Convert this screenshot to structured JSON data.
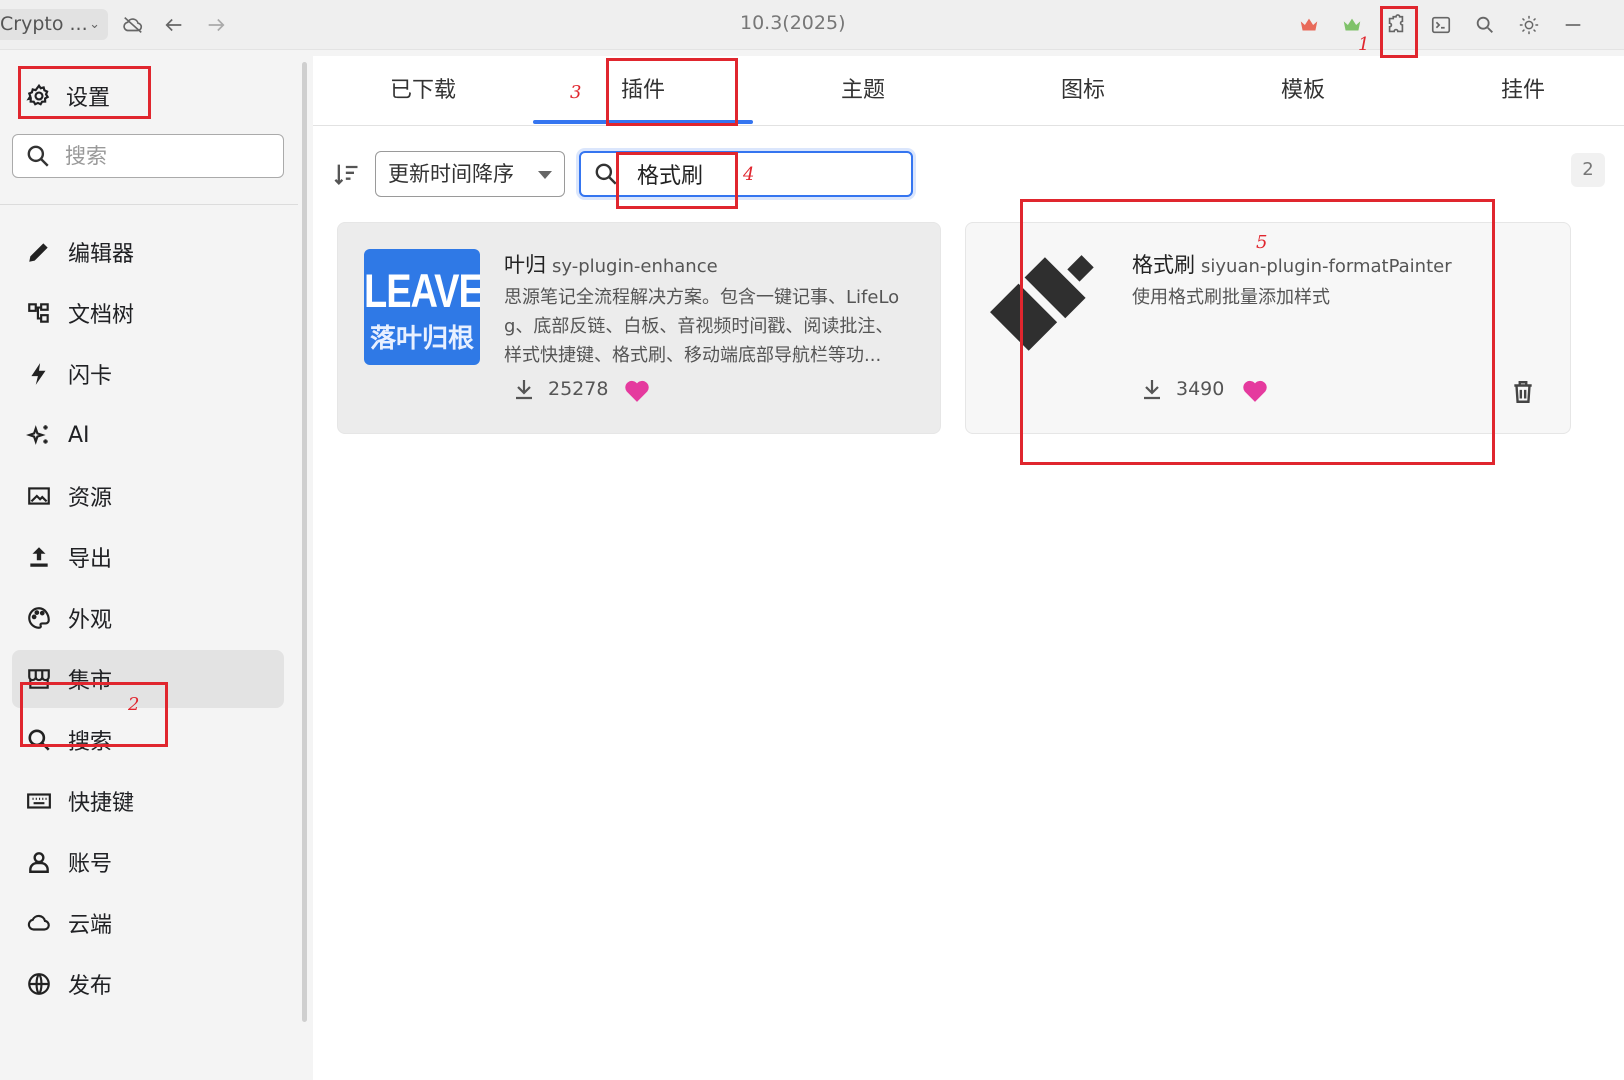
{
  "titlebar": {
    "workspace": "Crypto ...",
    "version": "10.3(2025)",
    "icons": [
      "cloud-off-icon",
      "arrow-left-icon",
      "arrow-right-icon",
      "crown-red-icon",
      "crown-green-icon",
      "puzzle-icon",
      "terminal-icon",
      "search-icon",
      "sun-icon",
      "minimize-icon"
    ],
    "colors": {
      "crown_red": "#e86a5a",
      "crown_green": "#7fc26a"
    }
  },
  "sidebar": {
    "title": "设置",
    "search_placeholder": "搜索",
    "items": [
      {
        "label": "编辑器",
        "icon": "pencil-icon"
      },
      {
        "label": "文档树",
        "icon": "tree-icon"
      },
      {
        "label": "闪卡",
        "icon": "lightning-icon"
      },
      {
        "label": "AI",
        "icon": "sparkle-icon"
      },
      {
        "label": "资源",
        "icon": "image-icon"
      },
      {
        "label": "导出",
        "icon": "upload-icon"
      },
      {
        "label": "外观",
        "icon": "palette-icon"
      },
      {
        "label": "集市",
        "icon": "store-icon",
        "active": true
      },
      {
        "label": "搜索",
        "icon": "search-icon"
      },
      {
        "label": "快捷键",
        "icon": "keyboard-icon"
      },
      {
        "label": "账号",
        "icon": "user-icon"
      },
      {
        "label": "云端",
        "icon": "cloud-icon"
      },
      {
        "label": "发布",
        "icon": "globe-icon"
      }
    ]
  },
  "tabs": [
    "已下载",
    "插件",
    "主题",
    "图标",
    "模板",
    "挂件"
  ],
  "active_tab": "插件",
  "toolbar": {
    "sort_label": "更新时间降序",
    "search_value": "格式刷",
    "result_count": "2"
  },
  "plugins": [
    {
      "name": "叶归",
      "package": "sy-plugin-enhance",
      "desc_lines": [
        "思源笔记全流程解决方案。包含一键记事、LifeLo",
        "g、底部反链、白板、音视频时间戳、阅读批注、",
        "样式快捷键、格式刷、移动端底部导航栏等功..."
      ],
      "downloads": "25278",
      "thumb_line1": "LEAVES",
      "thumb_line2": "落叶归根"
    },
    {
      "name": "格式刷",
      "package": "siyuan-plugin-formatPainter",
      "desc_lines": [
        "使用格式刷批量添加样式"
      ],
      "downloads": "3490"
    }
  ],
  "annotations": [
    "1",
    "2",
    "3",
    "4",
    "5"
  ],
  "colors": {
    "accent": "#3575f0",
    "annotation": "#e0262e",
    "heart": "#e53a9e"
  }
}
